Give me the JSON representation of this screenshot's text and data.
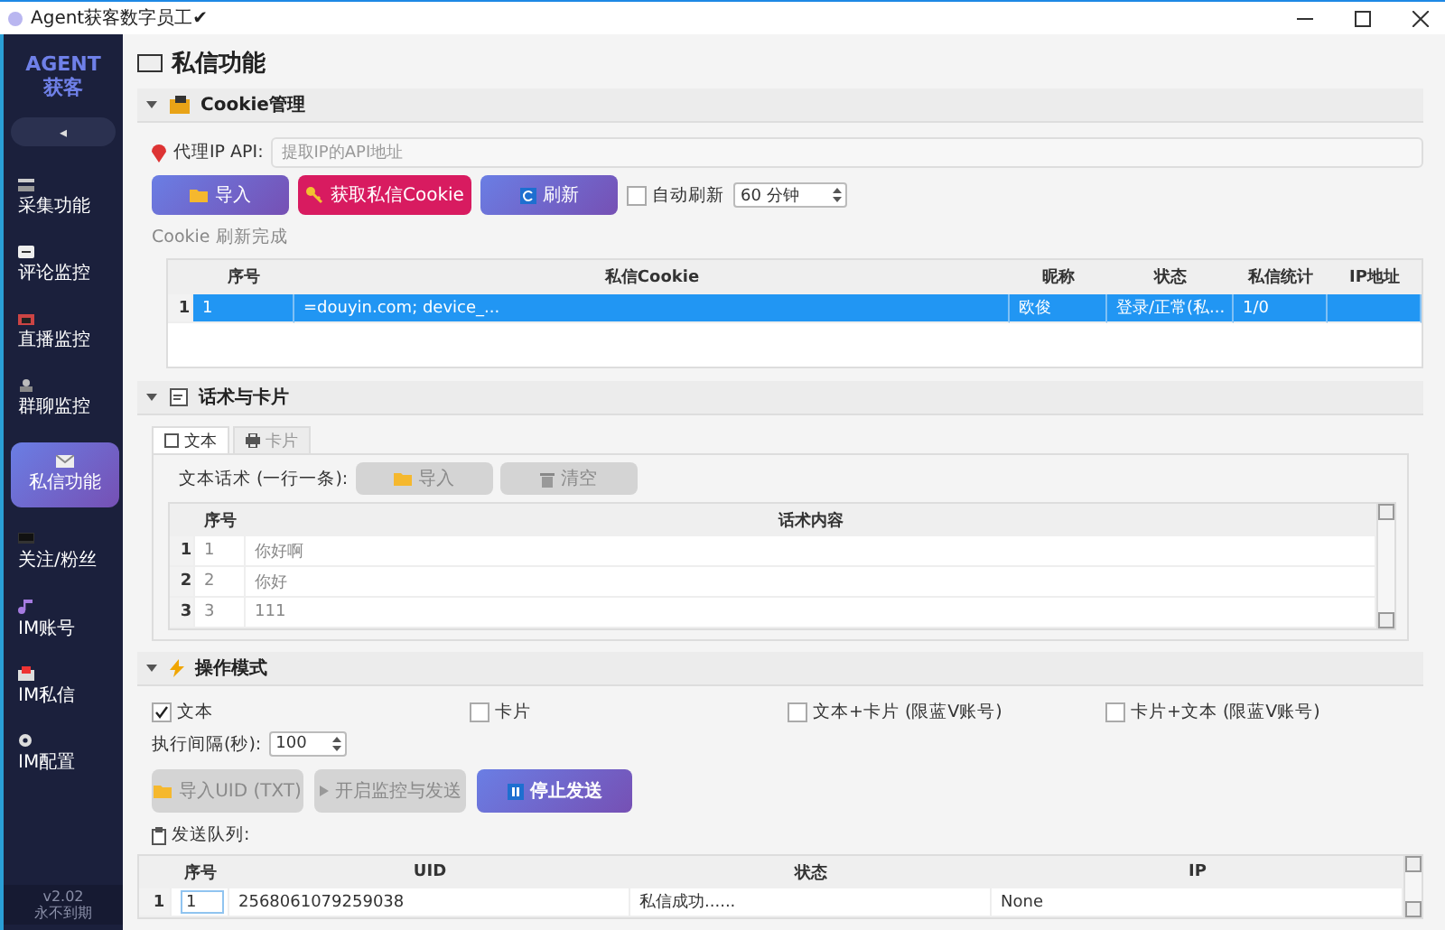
{
  "window": {
    "title": "Agent获客数字员工✔"
  },
  "sidebar": {
    "logo": [
      "AGENT",
      "获客"
    ],
    "collapse": "◂",
    "items": [
      {
        "label": "采集功能",
        "selected": false
      },
      {
        "label": "评论监控",
        "selected": false
      },
      {
        "label": "直播监控",
        "selected": false
      },
      {
        "label": "群聊监控",
        "selected": false
      },
      {
        "label": "私信功能",
        "selected": true
      },
      {
        "label": "关注/粉丝",
        "selected": false
      },
      {
        "label": "IM账号",
        "selected": false
      },
      {
        "label": "IM私信",
        "selected": false
      },
      {
        "label": "IM配置",
        "selected": false
      }
    ],
    "version": "v2.02",
    "license": "永不到期"
  },
  "page_title": "私信功能",
  "cookie_section": {
    "title": "Cookie管理",
    "expanded": true,
    "proxy_label": "代理IP API:",
    "proxy_placeholder": "提取IP的API地址",
    "buttons": [
      {
        "label": "导入",
        "kind": "primary"
      },
      {
        "label": "获取私信Cookie",
        "kind": "danger"
      },
      {
        "label": "刷新",
        "kind": "primary"
      }
    ],
    "auto_refresh": {
      "label": "自动刷新",
      "checked": false
    },
    "interval": "60 分钟",
    "status": "Cookie 刷新完成",
    "table": {
      "columns": [
        "序号",
        "私信Cookie",
        "昵称",
        "状态",
        "私信统计",
        "IP地址"
      ],
      "rows": [
        {
          "row_header": "1",
          "selected": true,
          "cells": [
            "1",
            "=douyin.com; device_...",
            "欧俊",
            "登录/正常(私...",
            "1/0"
          ]
        }
      ]
    }
  },
  "script_section": {
    "title": "话术与卡片",
    "expanded": true,
    "tabs": [
      {
        "label": "文本",
        "selected": true
      },
      {
        "label": "卡片",
        "selected": false
      }
    ],
    "label": "文本话术 (一行一条):",
    "buttons": [
      {
        "label": "导入",
        "disabled": true
      },
      {
        "label": "清空",
        "disabled": true
      }
    ],
    "table": {
      "columns": [
        "序号",
        "话术内容"
      ],
      "rows": [
        {
          "row_header": "1",
          "cells": [
            "1",
            "你好啊"
          ]
        },
        {
          "row_header": "2",
          "cells": [
            "2",
            "你好"
          ]
        },
        {
          "row_header": "3",
          "cells": [
            "3",
            "111"
          ]
        }
      ]
    }
  },
  "mode_section": {
    "title": "操作模式",
    "expanded": true,
    "options": [
      {
        "label": "文本",
        "checked": true
      },
      {
        "label": "卡片",
        "checked": false
      },
      {
        "label": "文本+卡片 (限蓝V账号)",
        "checked": false
      },
      {
        "label": "卡片+文本 (限蓝V账号)",
        "checked": false
      }
    ],
    "interval_label": "执行间隔(秒):",
    "interval": "100",
    "buttons": [
      {
        "label": "导入UID (TXT)",
        "disabled": true,
        "kind": "folder"
      },
      {
        "label": "开启监控与发送",
        "disabled": true,
        "kind": "play"
      },
      {
        "label": "停止发送",
        "disabled": false,
        "kind": "pause"
      }
    ],
    "queue_label": "发送队列:",
    "table": {
      "columns": [
        "序号",
        "UID",
        "状态",
        "IP"
      ],
      "rows": [
        {
          "row_header": "1",
          "cells": [
            "1",
            "2568061079259038",
            "私信成功......",
            "None"
          ]
        }
      ]
    }
  }
}
